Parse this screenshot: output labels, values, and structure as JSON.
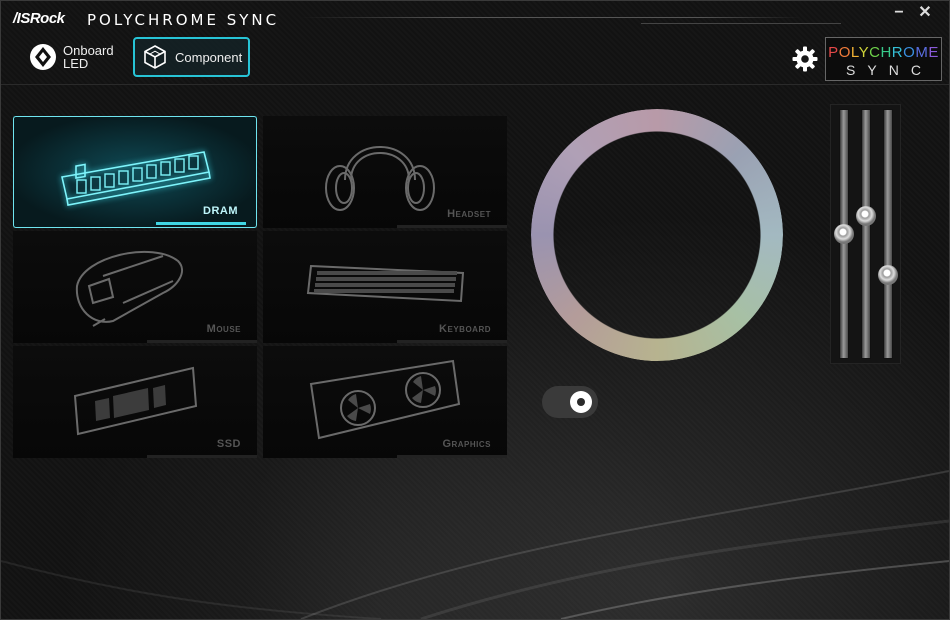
{
  "titlebar": {
    "brand": "/ISRock",
    "title": "POLYCHROME SYNC",
    "minimize_symbol": "−",
    "close_symbol": "✕"
  },
  "nav": {
    "tabs": [
      {
        "label_line1": "Onboard",
        "label_line2": "LED",
        "icon": "onboard-led-icon",
        "active": false
      },
      {
        "label": "Component",
        "icon": "component-cube-icon",
        "active": true
      }
    ],
    "settings_icon": "gear-icon",
    "logo": {
      "top": "POLYCHROME",
      "bottom": "SYNC"
    }
  },
  "components": [
    {
      "label": "DRAM",
      "icon": "dram-icon",
      "active": true
    },
    {
      "label": "Headset",
      "icon": "headset-icon",
      "active": false
    },
    {
      "label": "Mouse",
      "icon": "mouse-icon",
      "active": false
    },
    {
      "label": "Keyboard",
      "icon": "keyboard-icon",
      "active": false
    },
    {
      "label": "SSD",
      "icon": "ssd-icon",
      "active": false
    },
    {
      "label": "Graphics",
      "icon": "graphics-card-icon",
      "active": false
    }
  ],
  "color_wheel": {
    "icon": "color-ring"
  },
  "sliders": [
    {
      "name": "slider-1",
      "value": 0.5
    },
    {
      "name": "slider-2",
      "value": 0.58
    },
    {
      "name": "slider-3",
      "value": 0.32
    }
  ],
  "toggle": {
    "state": "on"
  },
  "colors": {
    "accent": "#27c4d6",
    "active_glow": "#6fe5f0",
    "inactive_label": "#555555",
    "background": "#131313"
  }
}
